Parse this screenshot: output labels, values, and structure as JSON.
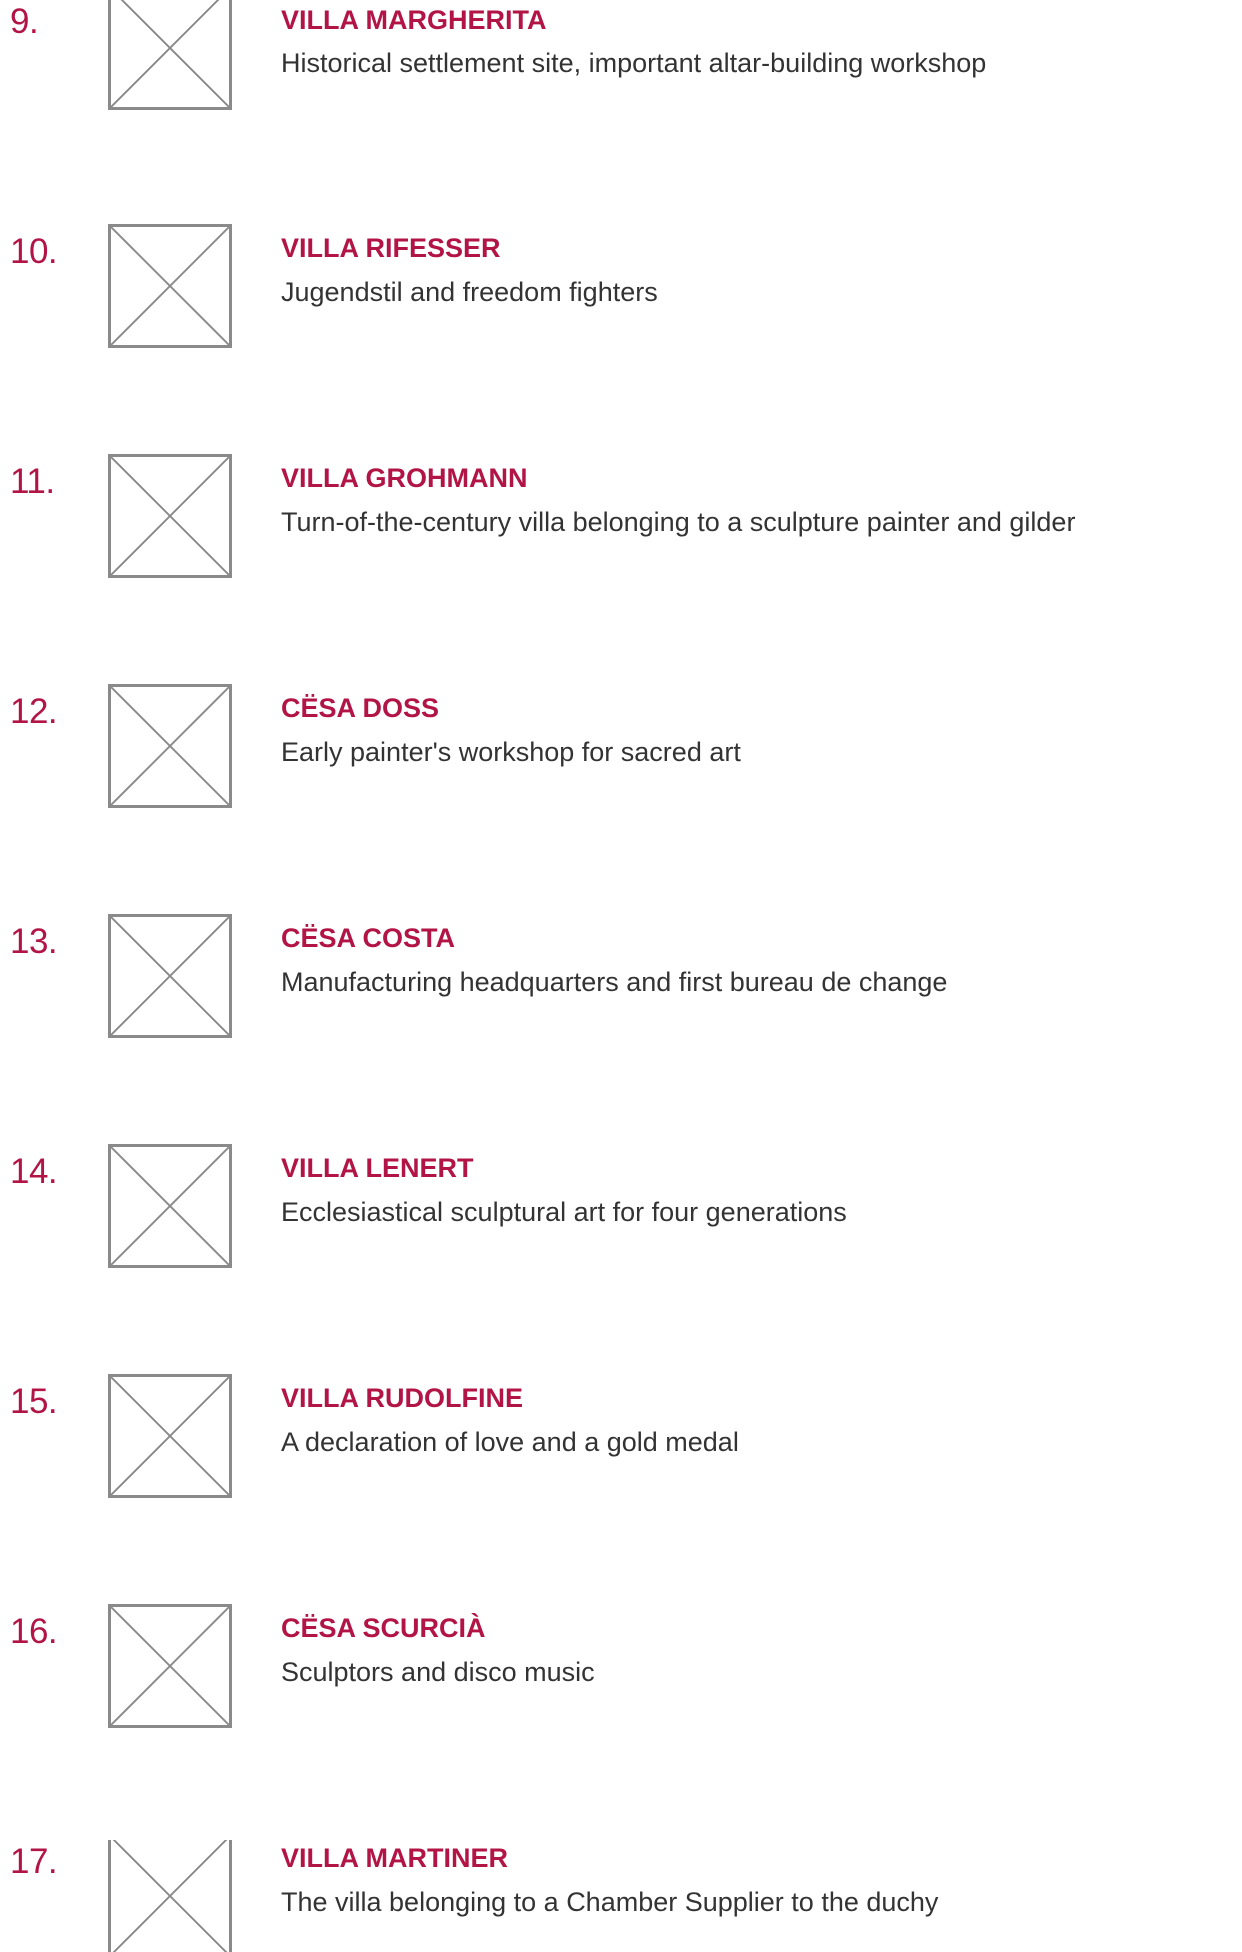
{
  "accent_color": "#b31446",
  "text_color": "#333333",
  "placeholder_color": "#8a8a8a",
  "items": [
    {
      "number": "9.",
      "title": "VILLA MARGHERITA",
      "description": "Historical settlement site, important altar-building workshop",
      "image": "image-placeholder-icon"
    },
    {
      "number": "10.",
      "title": "VILLA RIFESSER",
      "description": "Jugendstil and freedom fighters",
      "image": "image-placeholder-icon"
    },
    {
      "number": "11.",
      "title": "VILLA GROHMANN",
      "description": "Turn-of-the-century villa belonging to a sculpture painter and gilder",
      "image": "image-placeholder-icon"
    },
    {
      "number": "12.",
      "title": "CËSA DOSS",
      "description": "Early painter's workshop for sacred art",
      "image": "image-placeholder-icon"
    },
    {
      "number": "13.",
      "title": "CËSA COSTA",
      "description": "Manufacturing headquarters and first bureau de change",
      "image": "image-placeholder-icon"
    },
    {
      "number": "14.",
      "title": "VILLA LENERT",
      "description": "Ecclesiastical sculptural art for four generations",
      "image": "image-placeholder-icon"
    },
    {
      "number": "15.",
      "title": "VILLA RUDOLFINE",
      "description": "A declaration of love and a gold medal",
      "image": "image-placeholder-icon"
    },
    {
      "number": "16.",
      "title": "CËSA SCURCIÀ",
      "description": "Sculptors and disco music",
      "image": "image-placeholder-icon"
    },
    {
      "number": "17.",
      "title": "VILLA MARTINER",
      "description": "The villa belonging to a Chamber Supplier to the duchy",
      "image": "image-placeholder-icon"
    }
  ]
}
